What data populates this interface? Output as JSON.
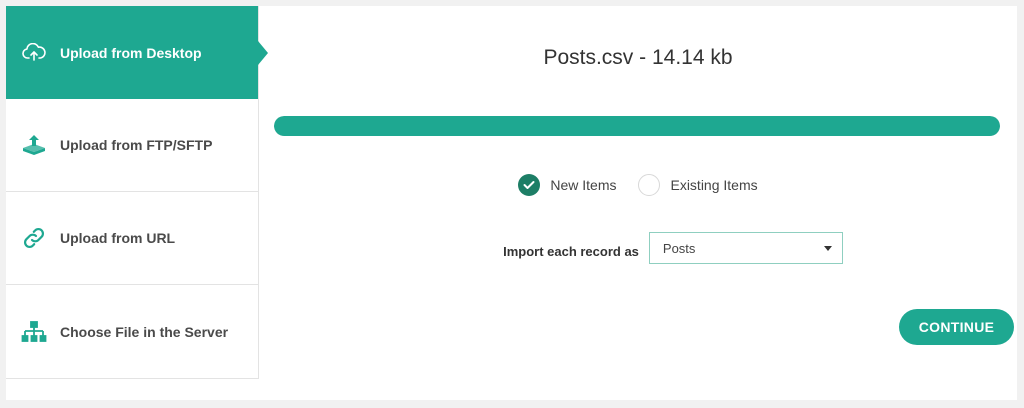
{
  "sidebar": {
    "items": [
      {
        "label": "Upload from Desktop",
        "icon": "cloud-upload-icon",
        "active": true
      },
      {
        "label": "Upload from FTP/SFTP",
        "icon": "ftp-upload-icon",
        "active": false
      },
      {
        "label": "Upload from URL",
        "icon": "link-icon",
        "active": false
      },
      {
        "label": "Choose File in the Server",
        "icon": "server-tree-icon",
        "active": false
      }
    ]
  },
  "main": {
    "file_title": "Posts.csv - 14.14 kb",
    "upload_progress_percent": 100,
    "radios": {
      "new_items": {
        "label": "New Items",
        "checked": true
      },
      "existing_items": {
        "label": "Existing Items",
        "checked": false
      }
    },
    "import": {
      "label": "Import each record as",
      "selected": "Posts"
    },
    "continue_label": "CONTINUE"
  },
  "colors": {
    "accent": "#1ea891",
    "check": "#1d7e66",
    "icon": "#1ea891"
  }
}
